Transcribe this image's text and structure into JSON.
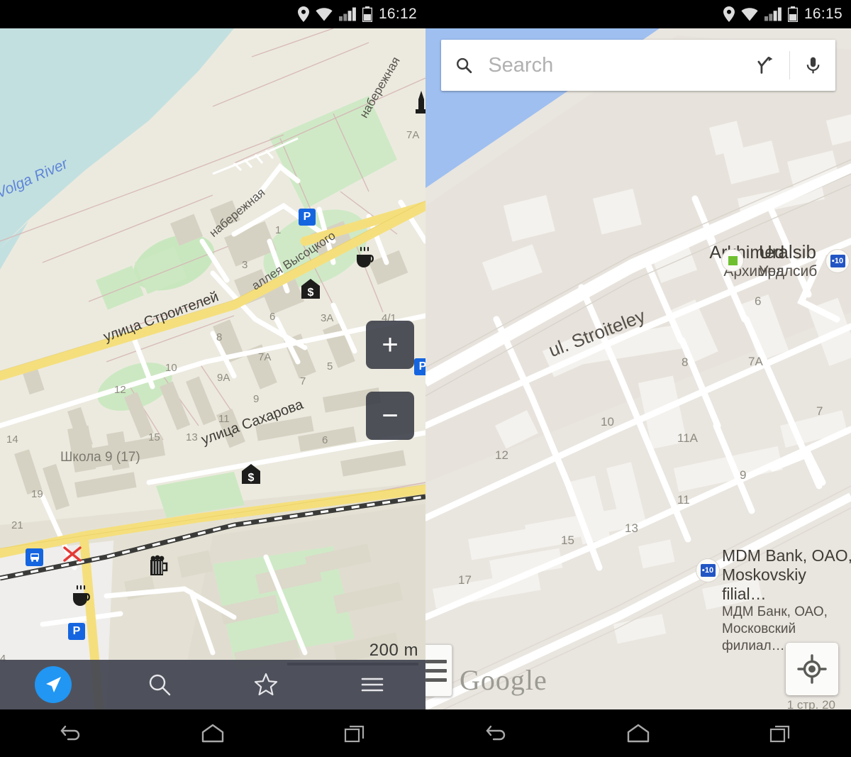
{
  "left_phone": {
    "statusbar": {
      "clock": "16:12",
      "icons": [
        "location-pin-icon",
        "wifi-icon",
        "signal-icon",
        "battery-icon"
      ]
    },
    "app": "offline-map-app",
    "map": {
      "water_label": "Volga River",
      "scale_label": "200 m",
      "streets": [
        {
          "name": "набережная"
        },
        {
          "name": "набережная"
        },
        {
          "name": "аллея Высоцкого"
        },
        {
          "name": "улица Строителей"
        },
        {
          "name": "улица Сахарова"
        }
      ],
      "places": [
        {
          "name": "Школа 9 (17)"
        }
      ],
      "house_numbers": [
        "7A",
        "1",
        "3",
        "3A",
        "4/1",
        "6",
        "8",
        "10",
        "12",
        "14",
        "7A",
        "5",
        "9A",
        "7",
        "9",
        "11",
        "13",
        "15",
        "6",
        "19",
        "21",
        "4"
      ],
      "poi_icons": [
        "parking-icon",
        "parking-icon",
        "parking-icon",
        "cafe-icon",
        "cafe-icon",
        "bank-icon",
        "bank-icon",
        "monument-icon",
        "pub-icon",
        "bus-stop-icon",
        "level-crossing-icon"
      ]
    },
    "zoom_controls": {
      "zoom_in": "+",
      "zoom_out": "−"
    },
    "bottom_bar": {
      "items": [
        {
          "name": "navigate",
          "icon": "navigation-arrow-icon"
        },
        {
          "name": "search",
          "icon": "search-icon"
        },
        {
          "name": "favorites",
          "icon": "star-icon"
        },
        {
          "name": "menu",
          "icon": "hamburger-menu-icon"
        }
      ],
      "accent_color": "#2196f3",
      "background_color": "#434652"
    }
  },
  "right_phone": {
    "statusbar": {
      "clock": "16:15",
      "icons": [
        "location-pin-icon",
        "wifi-icon",
        "signal-icon",
        "battery-icon"
      ]
    },
    "app": "google-maps",
    "search": {
      "placeholder": "Search",
      "value": "",
      "icons": [
        "search-icon",
        "directions-icon",
        "microphone-icon"
      ]
    },
    "map": {
      "streets": [
        {
          "name": "ul. Stroiteley"
        }
      ],
      "places": [
        {
          "name_latin": "Arkhimed",
          "name_cyrillic": "Архимед",
          "marker": "green-square-poi-icon"
        },
        {
          "name_latin": "Uralsib",
          "name_cyrillic": "Уралсиб",
          "marker": "parking-p10-icon"
        },
        {
          "name_latin_line1": "MDM Bank, OAO,",
          "name_latin_line2": "Moskovskiy filial…",
          "name_cyrillic_line1": "МДМ Банк, ОАО,",
          "name_cyrillic_line2": "Московский филиал…",
          "marker": "parking-p10-icon"
        }
      ],
      "house_numbers": [
        "6",
        "7",
        "7A",
        "8",
        "9",
        "10",
        "11",
        "11A",
        "12",
        "13",
        "15",
        "17"
      ],
      "corner_text": "1 стр. 20",
      "watermark": "Google"
    },
    "controls": {
      "layers": "layers-button",
      "my_location": "my-location-icon"
    }
  },
  "android_nav": {
    "items": [
      {
        "name": "back",
        "icon": "back-icon"
      },
      {
        "name": "home",
        "icon": "home-icon"
      },
      {
        "name": "recents",
        "icon": "recents-icon"
      }
    ]
  }
}
